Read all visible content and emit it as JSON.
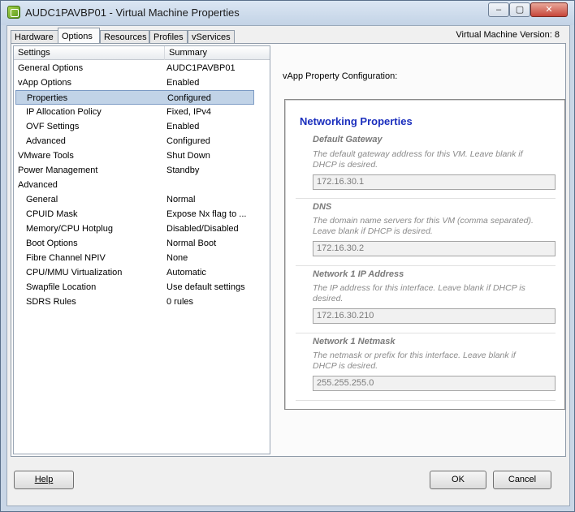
{
  "window": {
    "title": "AUDC1PAVBP01 - Virtual Machine Properties",
    "controls": {
      "minimize": "–",
      "maximize": "▢",
      "close": "✕"
    }
  },
  "tabs": [
    {
      "label": "Hardware",
      "active": false
    },
    {
      "label": "Options",
      "active": true
    },
    {
      "label": "Resources",
      "active": false
    },
    {
      "label": "Profiles",
      "active": false
    },
    {
      "label": "vServices",
      "active": false
    }
  ],
  "vm_version": "Virtual Machine Version: 8",
  "settings_list": {
    "headers": {
      "settings": "Settings",
      "summary": "Summary"
    },
    "rows": [
      {
        "setting": "General Options",
        "summary": "AUDC1PAVBP01"
      },
      {
        "setting": "vApp Options",
        "summary": "Enabled"
      },
      {
        "setting": "Properties",
        "summary": "Configured"
      },
      {
        "setting": "IP Allocation Policy",
        "summary": "Fixed, IPv4"
      },
      {
        "setting": "OVF Settings",
        "summary": "Enabled"
      },
      {
        "setting": "Advanced",
        "summary": "Configured"
      },
      {
        "setting": "VMware Tools",
        "summary": "Shut Down"
      },
      {
        "setting": "Power Management",
        "summary": "Standby"
      },
      {
        "setting": "Advanced",
        "summary": ""
      },
      {
        "setting": "General",
        "summary": "Normal"
      },
      {
        "setting": "CPUID Mask",
        "summary": "Expose Nx flag to ..."
      },
      {
        "setting": "Memory/CPU Hotplug",
        "summary": "Disabled/Disabled"
      },
      {
        "setting": "Boot Options",
        "summary": "Normal Boot"
      },
      {
        "setting": "Fibre Channel NPIV",
        "summary": "None"
      },
      {
        "setting": "CPU/MMU Virtualization",
        "summary": "Automatic"
      },
      {
        "setting": "Swapfile Location",
        "summary": "Use default settings"
      },
      {
        "setting": "SDRS Rules",
        "summary": "0 rules"
      }
    ],
    "selected_row": "Properties"
  },
  "vapp_config": {
    "label": "vApp Property Configuration:",
    "section_title": "Networking Properties",
    "properties": [
      {
        "name": "Default Gateway",
        "description": "The default gateway address for this VM. Leave blank if DHCP is desired.",
        "value": "172.16.30.1"
      },
      {
        "name": "DNS",
        "description": "The domain name servers for this VM (comma separated). Leave blank if DHCP is desired.",
        "value": "172.16.30.2"
      },
      {
        "name": "Network 1 IP Address",
        "description": "The IP address for this interface. Leave blank if DHCP is desired.",
        "value": "172.16.30.210"
      },
      {
        "name": "Network 1 Netmask",
        "description": "The netmask or prefix for this interface. Leave blank if DHCP is desired.",
        "value": "255.255.255.0"
      }
    ]
  },
  "buttons": {
    "help": "Help",
    "ok": "OK",
    "cancel": "Cancel"
  }
}
